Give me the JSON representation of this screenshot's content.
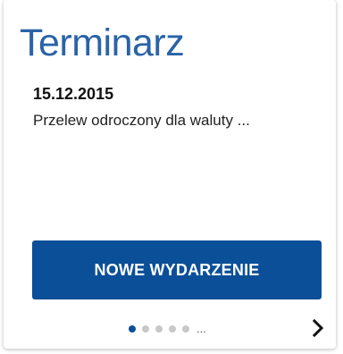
{
  "widget": {
    "title": "Terminarz"
  },
  "event": {
    "date": "15.12.2015",
    "description": "Przelew odroczony dla waluty ..."
  },
  "actions": {
    "new_event_label": "NOWE WYDARZENIE"
  },
  "pagination": {
    "total_dots": 5,
    "active_index": 0,
    "more_label": "..."
  },
  "icons": {
    "next": "chevron-right-icon"
  },
  "colors": {
    "title": "#2a63a8",
    "button": "#0a4f98",
    "dot_active": "#0a4f98",
    "dot_inactive": "#c8c8c8"
  }
}
